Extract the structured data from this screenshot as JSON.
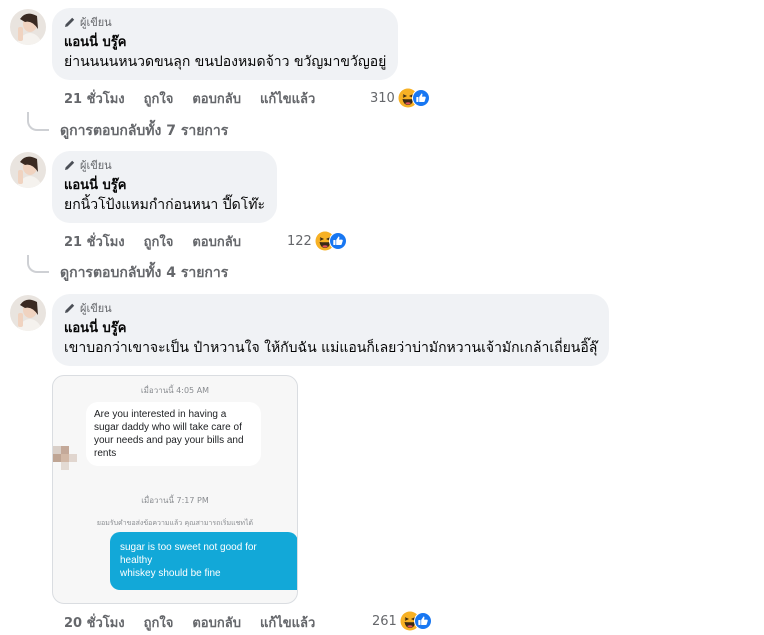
{
  "comments": [
    {
      "badge": "ผู้เขียน",
      "author": "แอนนี่ บรู๊ค",
      "text": "ย่านนนนหนวดขนลุก ขนปองหมดจ้าว ขวัญมาขวัญอยู่",
      "time": "21 ชั่วโมง",
      "like_label": "ถูกใจ",
      "reply_label": "ตอบกลับ",
      "edited_label": "แก้ไขแล้ว",
      "reaction_count": "310",
      "view_replies": "ดูการตอบกลับทั้ง 7 รายการ"
    },
    {
      "badge": "ผู้เขียน",
      "author": "แอนนี่ บรู๊ค",
      "text": "ยกนิ้วโป้งแหมกำก่อนหนา ปี๊ดโท๊ะ",
      "time": "21 ชั่วโมง",
      "like_label": "ถูกใจ",
      "reply_label": "ตอบกลับ",
      "reaction_count": "122",
      "view_replies": "ดูการตอบกลับทั้ง 4 รายการ"
    },
    {
      "badge": "ผู้เขียน",
      "author": "แอนนี่ บรู๊ค",
      "text": "เขาบอกว่าเขาจะเป็น ป๋าหวานใจ ให้กับฉัน แม่แอนก็เลยว่าบ่ามักหวานเจ้ามักเกล้าเถี่ยนอิ๊ลุ๊",
      "time": "20 ชั่วโมง",
      "like_label": "ถูกใจ",
      "reply_label": "ตอบกลับ",
      "edited_label": "แก้ไขแล้ว",
      "reaction_count": "261"
    }
  ],
  "attachment": {
    "time1": "เมื่อวานนี้ 4:05 AM",
    "incoming_message": "Are you interested in having a sugar daddy who will take care of your needs and pay your bills and rents",
    "time2": "เมื่อวานนี้ 7:17 PM",
    "notice": "ยอมรับคำขอส่งข้อความแล้ว คุณสามารถเริ่มแชทได้",
    "outgoing_message_line1": "sugar is too sweet not good for",
    "outgoing_message_line2": "healthy",
    "outgoing_message_line3": "whiskey should be fine"
  },
  "colors": {
    "bubble": "#f0f2f5",
    "meta_text": "#65676b",
    "like_blue": "#1877f2",
    "haha_yellow": "#f7b125",
    "outgoing_message": "#12a8d8"
  },
  "icons": {
    "badge": "pencil-icon",
    "reaction_1": "haha-emoji-icon",
    "reaction_2": "like-thumb-icon"
  }
}
